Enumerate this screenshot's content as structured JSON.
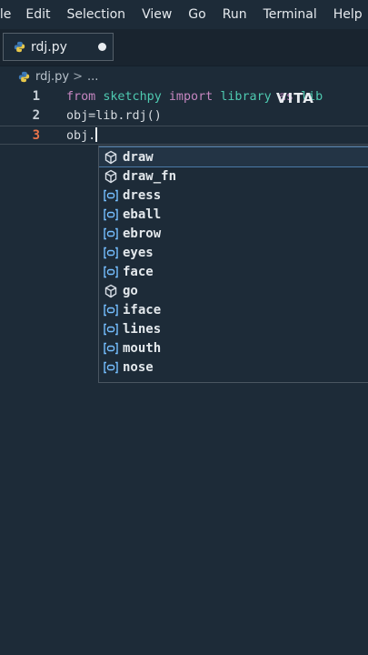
{
  "menubar": {
    "items": [
      "ile",
      "Edit",
      "Selection",
      "View",
      "Go",
      "Run",
      "Terminal",
      "Help"
    ]
  },
  "tab": {
    "label": "rdj.py"
  },
  "breadcrumb": {
    "file": "rdj.py",
    "separator": ">",
    "rest": "..."
  },
  "editor": {
    "lines": [
      {
        "number": "1",
        "tokens": [
          "from",
          "sketchpy",
          "import",
          "library",
          "as",
          "lib"
        ]
      },
      {
        "number": "2",
        "text": "obj=lib.rdj()"
      },
      {
        "number": "3",
        "text": "obj."
      }
    ],
    "watermark": "VITA"
  },
  "suggestions": [
    {
      "label": "draw",
      "icon": "method-cube-icon"
    },
    {
      "label": "draw_fn",
      "icon": "method-cube-icon"
    },
    {
      "label": "dress",
      "icon": "variable-icon"
    },
    {
      "label": "eball",
      "icon": "variable-icon"
    },
    {
      "label": "ebrow",
      "icon": "variable-icon"
    },
    {
      "label": "eyes",
      "icon": "variable-icon"
    },
    {
      "label": "face",
      "icon": "variable-icon"
    },
    {
      "label": "go",
      "icon": "method-cube-icon"
    },
    {
      "label": "iface",
      "icon": "variable-icon"
    },
    {
      "label": "lines",
      "icon": "variable-icon"
    },
    {
      "label": "mouth",
      "icon": "variable-icon"
    },
    {
      "label": "nose",
      "icon": "variable-icon"
    }
  ],
  "colors": {
    "background": "#1d2b38",
    "keyword": "#c586c0",
    "module": "#4ec9b0",
    "current_line_number": "#e8734a"
  }
}
